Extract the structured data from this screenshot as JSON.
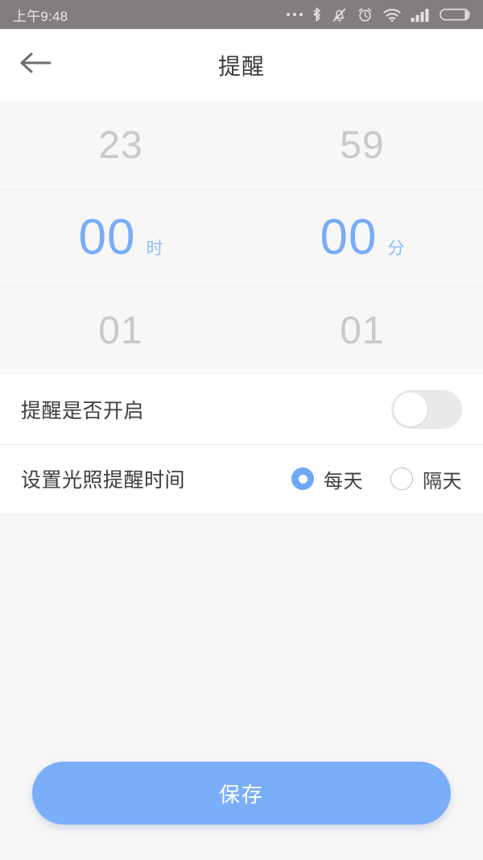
{
  "statusbar": {
    "time": "上午9:48",
    "icons": [
      "more-dots-icon",
      "bluetooth-icon",
      "mute-bell-icon",
      "alarm-clock-icon",
      "wifi-icon",
      "signal-bars-icon",
      "battery-icon"
    ]
  },
  "header": {
    "back_icon": "back-arrow-icon",
    "title": "提醒"
  },
  "time_picker": {
    "hour": {
      "prev": "23",
      "selected": "00",
      "next": "01",
      "unit": "时"
    },
    "minute": {
      "prev": "59",
      "selected": "00",
      "next": "01",
      "unit": "分"
    }
  },
  "settings": {
    "reminder_toggle": {
      "label": "提醒是否开启",
      "state": "off"
    },
    "frequency": {
      "label": "设置光照提醒时间",
      "options": [
        {
          "label": "每天",
          "selected": true
        },
        {
          "label": "隔天",
          "selected": false
        }
      ]
    }
  },
  "footer": {
    "save_label": "保存"
  },
  "colors": {
    "accent_blue": "#7BAEF8",
    "selected_text_blue": "#79ACF7",
    "statusbar_gray": "#837E7E",
    "page_background": "#F6F6F6",
    "card_white": "#FFFFFF",
    "ghost_gray": "#C9C9C9"
  }
}
